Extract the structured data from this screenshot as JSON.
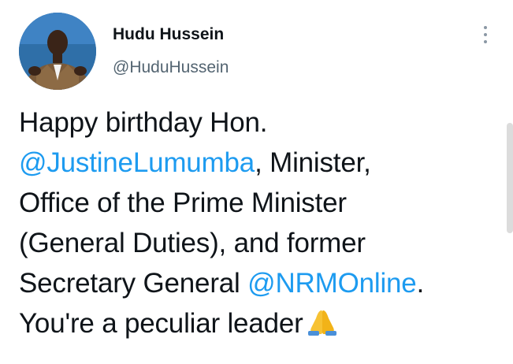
{
  "tweet": {
    "author": {
      "display_name": "Hudu Hussein",
      "handle": "@HuduHussein",
      "avatar_icon": "profile-photo"
    },
    "more_icon": "more-vertical-icon",
    "text_lines": [
      {
        "segments": [
          {
            "text": "Happy birthday Hon.",
            "type": "text"
          }
        ]
      },
      {
        "segments": [
          {
            "text": "@JustineLumumba",
            "type": "mention"
          },
          {
            "text": ", Minister,",
            "type": "text"
          }
        ]
      },
      {
        "segments": [
          {
            "text": "Office of the Prime Minister",
            "type": "text"
          }
        ]
      },
      {
        "segments": [
          {
            "text": "(General Duties), and former",
            "type": "text"
          }
        ]
      },
      {
        "segments": [
          {
            "text": "Secretary General ",
            "type": "text"
          },
          {
            "text": "@NRMOnline",
            "type": "mention"
          },
          {
            "text": ".",
            "type": "text"
          }
        ]
      },
      {
        "segments": [
          {
            "text": "You're a peculiar leader",
            "type": "text"
          }
        ]
      }
    ],
    "trailing_emoji": "folded-hands-emoji"
  },
  "colors": {
    "text": "#0f1419",
    "secondary": "#536471",
    "mention": "#1d9bf0",
    "background": "#ffffff"
  }
}
